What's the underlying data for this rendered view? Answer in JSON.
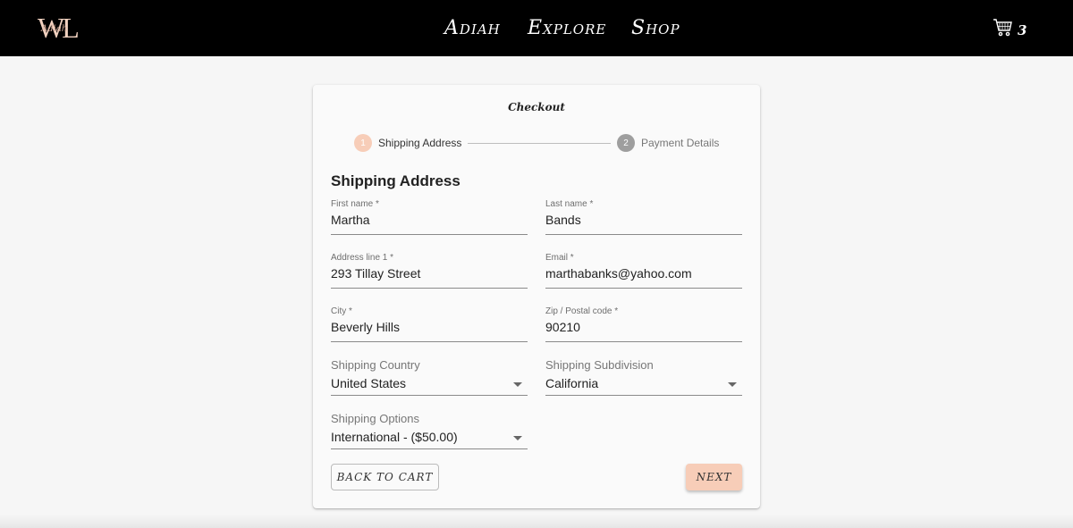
{
  "header": {
    "logo_text": "WL",
    "logo_script": "Adiah",
    "nav": [
      "Adiah",
      "Explore",
      "Shop"
    ],
    "cart_icon": "cart-icon",
    "cart_count": "3"
  },
  "checkout": {
    "title": "Checkout",
    "steps": [
      {
        "number": "1",
        "label": "Shipping Address",
        "active": true
      },
      {
        "number": "2",
        "label": "Payment Details",
        "active": false
      }
    ],
    "section_title": "Shipping Address",
    "fields": {
      "first_name": {
        "label": "First name *",
        "value": "Martha"
      },
      "last_name": {
        "label": "Last name *",
        "value": "Bands"
      },
      "address1": {
        "label": "Address line 1 *",
        "value": "293 Tillay Street"
      },
      "email": {
        "label": "Email *",
        "value": "marthabanks@yahoo.com"
      },
      "city": {
        "label": "City *",
        "value": "Beverly Hills"
      },
      "zip": {
        "label": "Zip / Postal code *",
        "value": "90210"
      },
      "country": {
        "label": "Shipping Country",
        "value": "United States"
      },
      "subdivision": {
        "label": "Shipping Subdivision",
        "value": "California"
      },
      "options": {
        "label": "Shipping Options",
        "value": "International - ($50.00)"
      }
    },
    "back_label": "Back to cart",
    "next_label": "Next"
  },
  "colors": {
    "accent": "#f7cdb8",
    "header_bg": "#000000",
    "page_bg": "#f6f6f6",
    "inactive_step": "#9e9e9e"
  }
}
